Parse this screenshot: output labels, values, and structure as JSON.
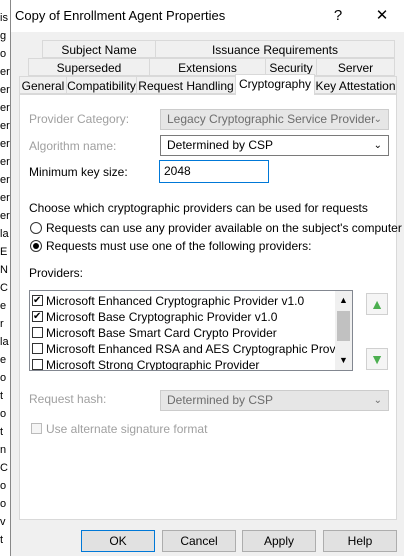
{
  "window": {
    "title": "Copy of Enrollment Agent Properties",
    "help_label": "?",
    "close_label": "✕"
  },
  "left_strip_chars": [
    "is",
    "g",
    "o",
    "er",
    "er",
    "er",
    "er",
    "er",
    "er",
    "er",
    "er",
    "er",
    "la",
    "E",
    "N",
    "C",
    "e",
    "r",
    "la",
    "e",
    "o",
    "t",
    "o",
    "t",
    "n",
    "C",
    "o",
    "o",
    "v",
    "t"
  ],
  "tabs_row1": [
    "Subject Name",
    "Issuance Requirements"
  ],
  "tabs_row2": [
    "Superseded Templates",
    "Extensions",
    "Security",
    "Server"
  ],
  "tabs_row3": [
    "General",
    "Compatibility",
    "Request Handling",
    "Cryptography",
    "Key Attestation"
  ],
  "active_tab": "Cryptography",
  "provider_category": {
    "label": "Provider Category:",
    "value": "Legacy Cryptographic Service Provider"
  },
  "algorithm": {
    "label": "Algorithm name:",
    "value": "Determined by CSP"
  },
  "min_key": {
    "label": "Minimum key size:",
    "value": "2048"
  },
  "choose_text": "Choose which cryptographic providers can be used for requests",
  "radio_any": "Requests can use any provider available on the subject's computer",
  "radio_must": "Requests must use one of the following providers:",
  "providers_label": "Providers:",
  "providers": [
    {
      "name": "Microsoft Enhanced Cryptographic Provider v1.0",
      "checked": true
    },
    {
      "name": "Microsoft Base Cryptographic Provider v1.0",
      "checked": true
    },
    {
      "name": "Microsoft Base Smart Card Crypto Provider",
      "checked": false
    },
    {
      "name": "Microsoft Enhanced RSA and AES Cryptographic Provider",
      "checked": false
    },
    {
      "name": "Microsoft Strong Cryptographic Provider",
      "checked": false
    }
  ],
  "request_hash": {
    "label": "Request hash:",
    "value": "Determined by CSP"
  },
  "alt_sig": "Use alternate signature format",
  "buttons": {
    "ok": "OK",
    "cancel": "Cancel",
    "apply": "Apply",
    "help": "Help"
  },
  "glyphs": {
    "up": "▲",
    "down": "▼",
    "combo": "⌄"
  }
}
